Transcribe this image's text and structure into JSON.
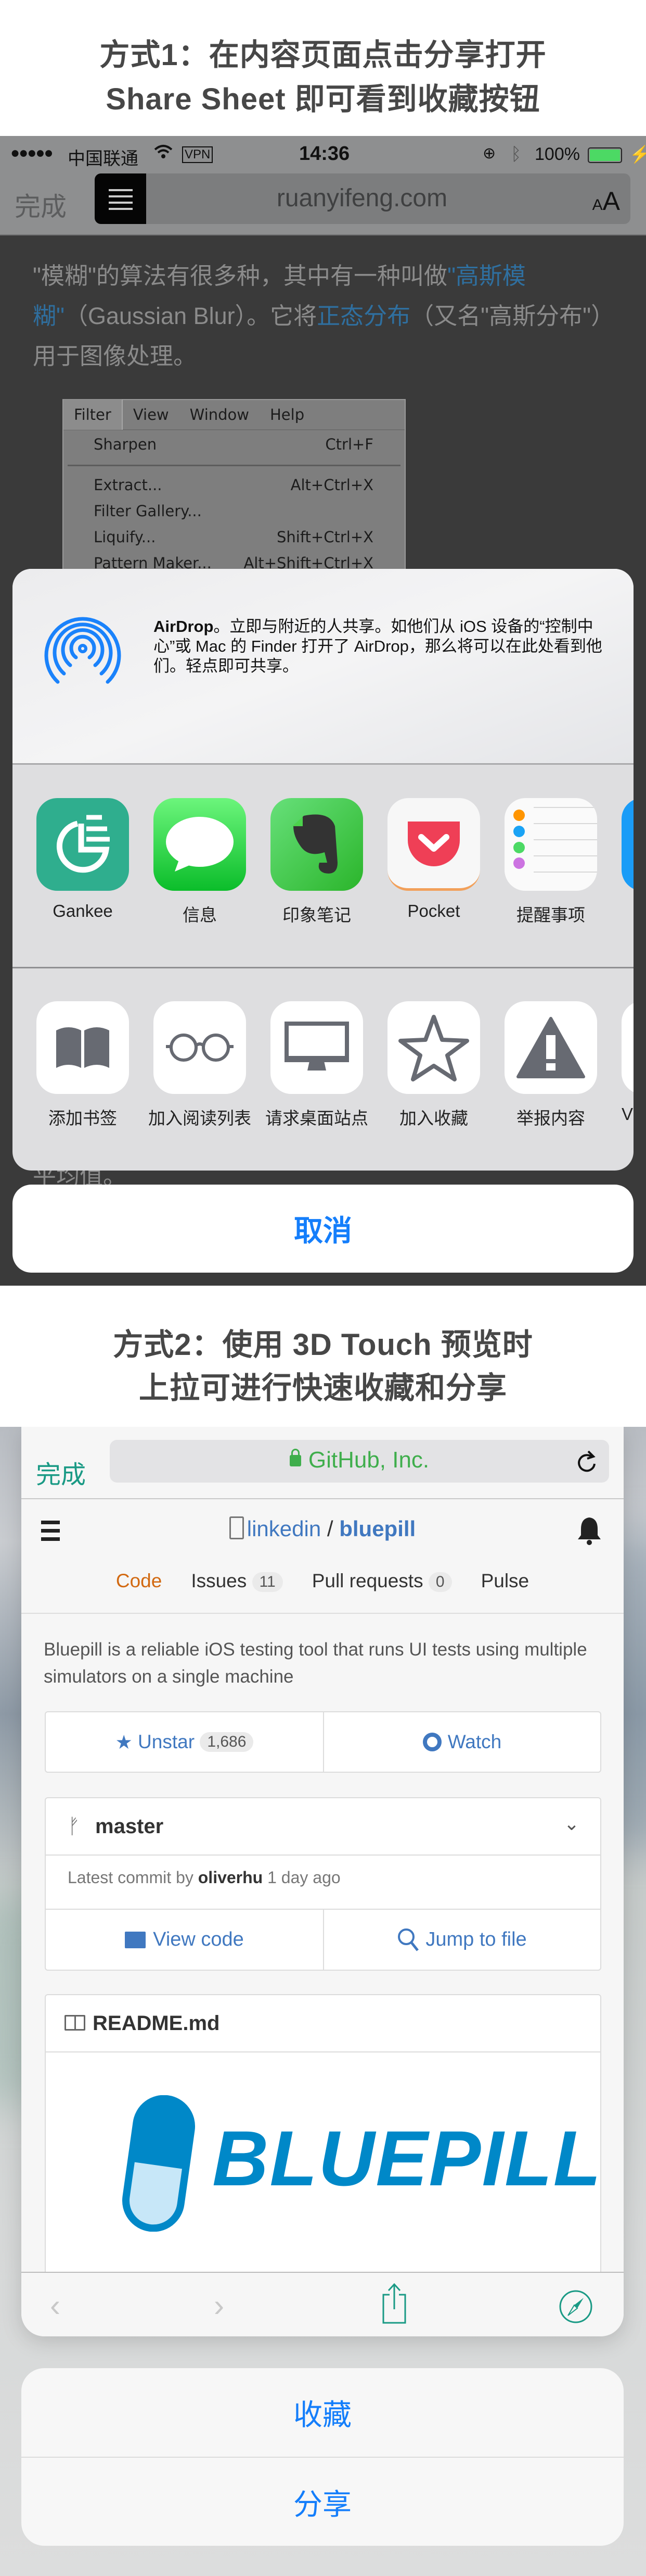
{
  "section1": {
    "title_lines": [
      "方式1：在内容页面点击分享打开",
      "Share Sheet 即可看到收藏按钮"
    ],
    "status": {
      "carrier": "中国联通",
      "vpn": "VPN",
      "time": "14:36",
      "battery": "100%",
      "battery_color": "#4cd964"
    },
    "safari": {
      "done": "完成",
      "url": "ruanyifeng.com",
      "text_size_small": "A",
      "text_size_large": "A"
    },
    "article": {
      "t1": "\"模糊\"的算法有很多种，其中有一种叫做",
      "link1": "\"高斯模糊\"",
      "t2": "（Gaussian Blur）。它将",
      "link2": "正态分布",
      "t3": "（又名\"高斯分布\"）用于图像处理。",
      "peek": "平均值。"
    },
    "menu": {
      "bar": [
        "Filter",
        "View",
        "Window",
        "Help"
      ],
      "items": [
        {
          "label": "Sharpen",
          "shortcut": "Ctrl+F"
        },
        {
          "label": "Extract...",
          "shortcut": "Alt+Ctrl+X"
        },
        {
          "label": "Filter Gallery...",
          "shortcut": ""
        },
        {
          "label": "Liquify...",
          "shortcut": "Shift+Ctrl+X"
        },
        {
          "label": "Pattern Maker...",
          "shortcut": "Alt+Shift+Ctrl+X"
        }
      ]
    },
    "share_sheet": {
      "airdrop_title": "AirDrop",
      "airdrop_text": "。立即与附近的人共享。如他们从 iOS 设备的“控制中心”或 Mac 的 Finder 打开了 AirDrop，那么将可以在此处看到他们。轻点即可共享。",
      "apps": [
        {
          "label": "Gankee",
          "icon": "gankee-icon",
          "color": "#2fae8e"
        },
        {
          "label": "信息",
          "icon": "messages-icon",
          "color": "#2ed158"
        },
        {
          "label": "印象笔记",
          "icon": "evernote-icon",
          "color": "#3ccc3c"
        },
        {
          "label": "Pocket",
          "icon": "pocket-icon",
          "color": "#ef3f56"
        },
        {
          "label": "提醒事项",
          "icon": "reminders-icon",
          "color": "#ffffff"
        }
      ],
      "actions": [
        {
          "label": "添加书签",
          "icon": "bookmark-icon"
        },
        {
          "label": "加入阅读列表",
          "icon": "glasses-icon"
        },
        {
          "label": "请求桌面站点",
          "icon": "desktop-icon"
        },
        {
          "label": "加入收藏",
          "icon": "star-icon"
        },
        {
          "label": "举报内容",
          "icon": "warning-icon"
        },
        {
          "label": "V",
          "icon": "partial-icon"
        }
      ],
      "cancel": "取消"
    }
  },
  "section2": {
    "title_lines": [
      "方式2：使用 3D Touch 预览时",
      "上拉可进行快速收藏和分享"
    ],
    "safari": {
      "done": "完成",
      "url": "GitHub, Inc."
    },
    "repo": {
      "owner": "linkedin",
      "sep": "/",
      "name": "bluepill"
    },
    "tabs": [
      {
        "label": "Code",
        "count": null
      },
      {
        "label": "Issues",
        "count": "11"
      },
      {
        "label": "Pull requests",
        "count": "0"
      },
      {
        "label": "Pulse",
        "count": null
      }
    ],
    "description": "Bluepill is a reliable iOS testing tool that runs UI tests using multiple simulators on a single machine",
    "unstar": "Unstar",
    "star_count": "1,686",
    "watch": "Watch",
    "branch": "master",
    "commit": {
      "prefix": "Latest commit by",
      "author": "oliverhu",
      "time": "1 day ago"
    },
    "view_code": "View code",
    "jump_to_file": "Jump to file",
    "readme": "README.md",
    "logo_text": "BLUEPILL",
    "quick_actions": [
      "收藏",
      "分享"
    ],
    "accent": "#147efb",
    "safari_tint": "#1a9a85"
  }
}
